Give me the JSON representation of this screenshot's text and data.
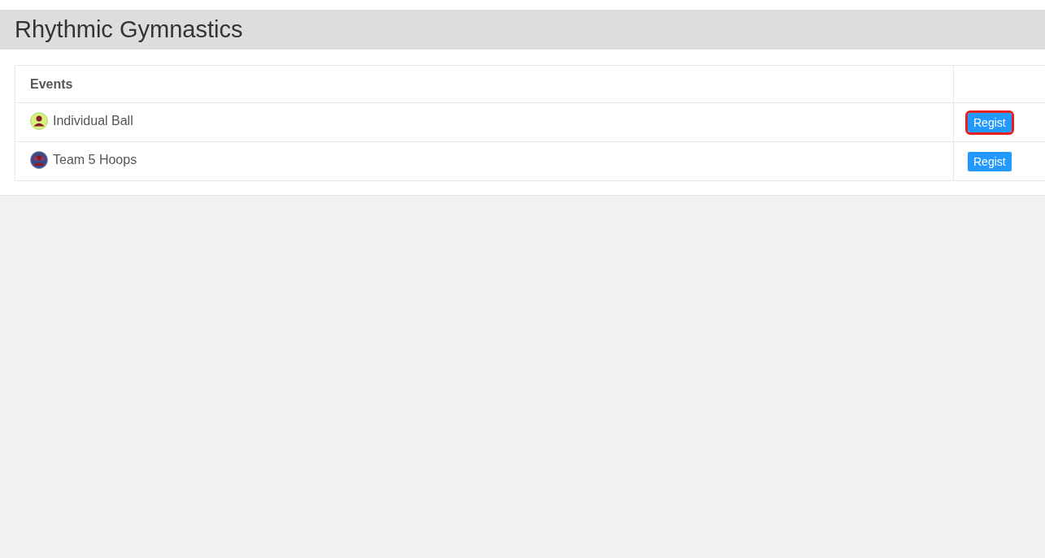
{
  "page": {
    "title": "Rhythmic Gymnastics"
  },
  "table": {
    "columns": [
      "Events"
    ],
    "rows": [
      {
        "kind": "individual",
        "event": "Individual Ball",
        "button": "Regist",
        "focused": true
      },
      {
        "kind": "team",
        "event": "Team 5 Hoops",
        "button": "Regist",
        "focused": false
      }
    ]
  }
}
